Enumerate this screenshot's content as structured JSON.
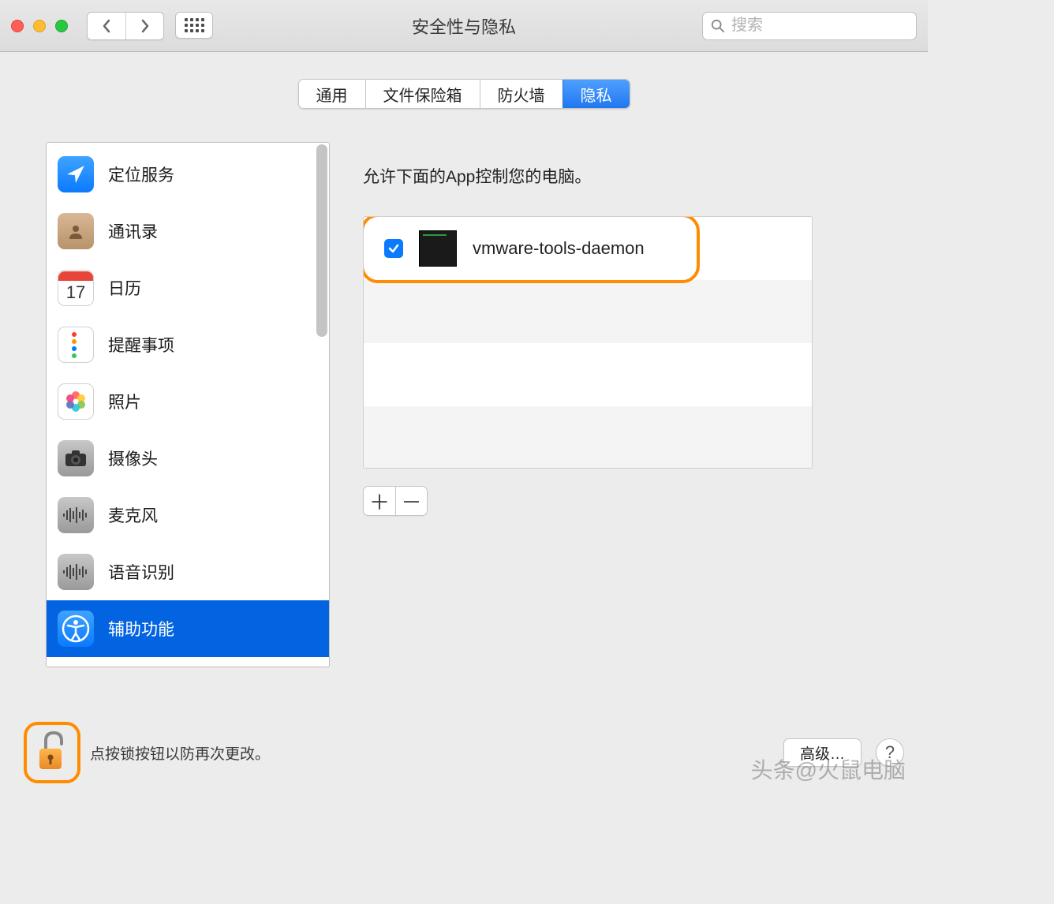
{
  "window": {
    "title": "安全性与隐私",
    "search_placeholder": "搜索"
  },
  "tabs": {
    "general": "通用",
    "filevault": "文件保险箱",
    "firewall": "防火墙",
    "privacy": "隐私"
  },
  "sidebar": {
    "items": [
      {
        "icon": "location",
        "label": "定位服务"
      },
      {
        "icon": "contacts",
        "label": "通讯录"
      },
      {
        "icon": "calendar",
        "label": "日历",
        "day": "17"
      },
      {
        "icon": "reminders",
        "label": "提醒事项"
      },
      {
        "icon": "photos",
        "label": "照片"
      },
      {
        "icon": "camera",
        "label": "摄像头"
      },
      {
        "icon": "microphone",
        "label": "麦克风"
      },
      {
        "icon": "speech",
        "label": "语音识别"
      },
      {
        "icon": "accessibility",
        "label": "辅助功能"
      }
    ]
  },
  "main": {
    "heading": "允许下面的App控制您的电脑。",
    "apps": [
      {
        "name": "vmware-tools-daemon",
        "checked": true
      }
    ]
  },
  "footer": {
    "lock_text": "点按锁按钮以防再次更改。",
    "advanced": "高级…",
    "help": "?"
  },
  "watermark": "头条@火鼠电脑"
}
